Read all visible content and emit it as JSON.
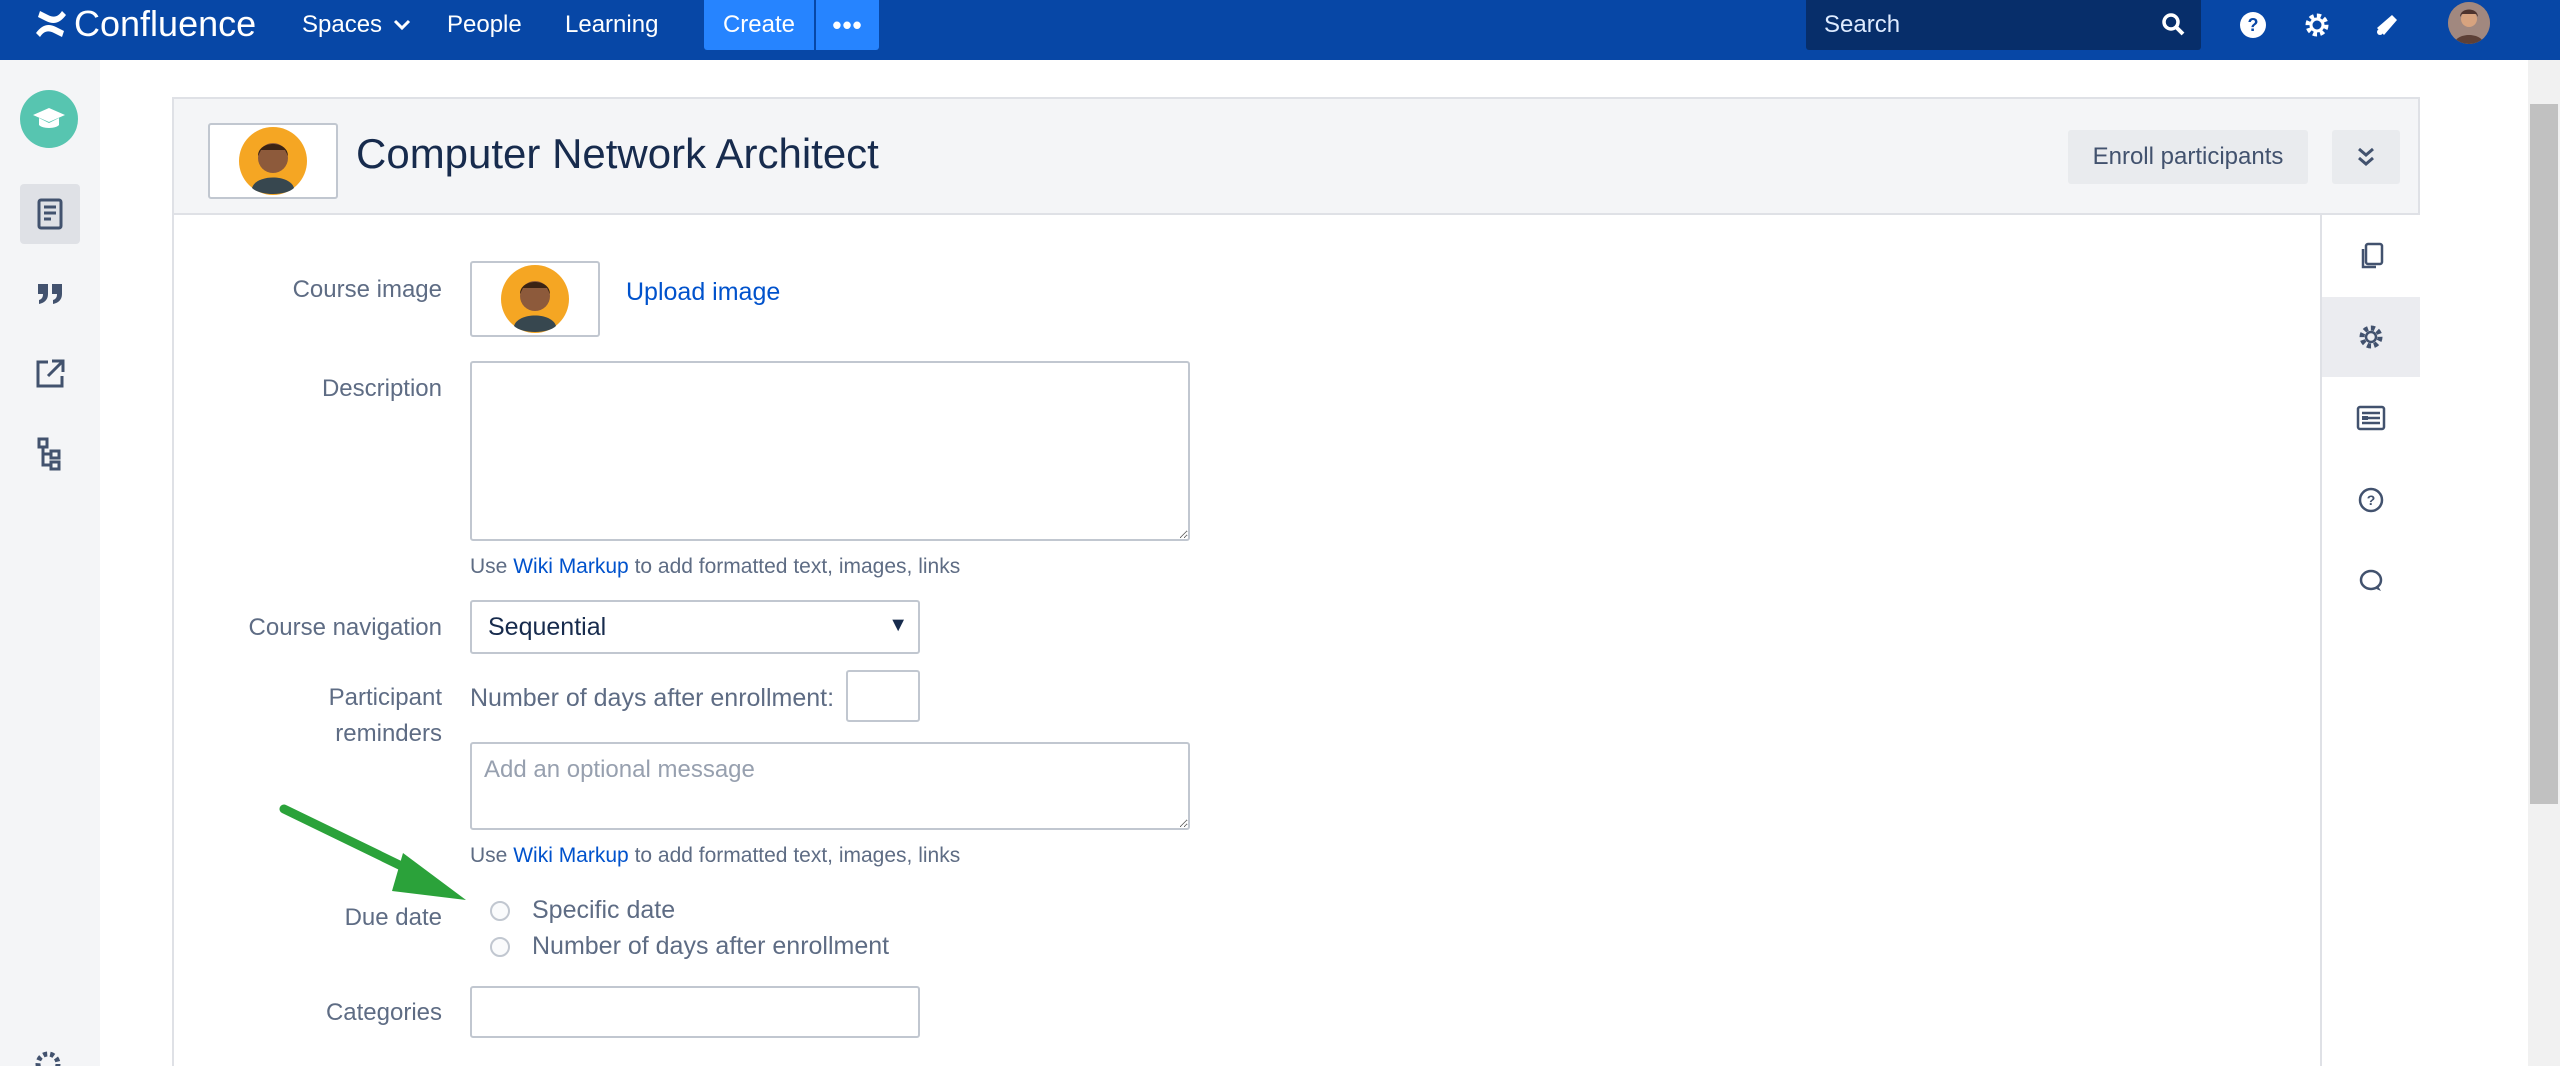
{
  "topbar": {
    "app_name": "Confluence",
    "nav": {
      "spaces": "Spaces",
      "people": "People",
      "learning": "Learning"
    },
    "create_label": "Create",
    "more_label": "•••",
    "search_placeholder": "Search"
  },
  "course": {
    "title": "Computer Network Architect",
    "enroll_label": "Enroll participants"
  },
  "form": {
    "course_image_label": "Course image",
    "upload_image_link": "Upload image",
    "description_label": "Description",
    "description_value": "",
    "hint_use": "Use",
    "hint_link": "Wiki Markup",
    "hint_rest": "to add formatted text, images, links",
    "course_navigation_label": "Course navigation",
    "course_navigation_value": "Sequential",
    "participant_label_line1": "Participant",
    "participant_label_line2": "reminders",
    "days_after_enrollment_label": "Number of days after enrollment:",
    "optional_message_placeholder": "Add an optional message",
    "due_date_label": "Due date",
    "due_date_options": [
      "Specific date",
      "Number of days after enrollment"
    ],
    "categories_label": "Categories"
  },
  "colors": {
    "topbar": "#0747a6",
    "create": "#2684ff",
    "link": "#0052cc",
    "arrow": "#2ba23a",
    "space_logo": "#57c5b0"
  }
}
